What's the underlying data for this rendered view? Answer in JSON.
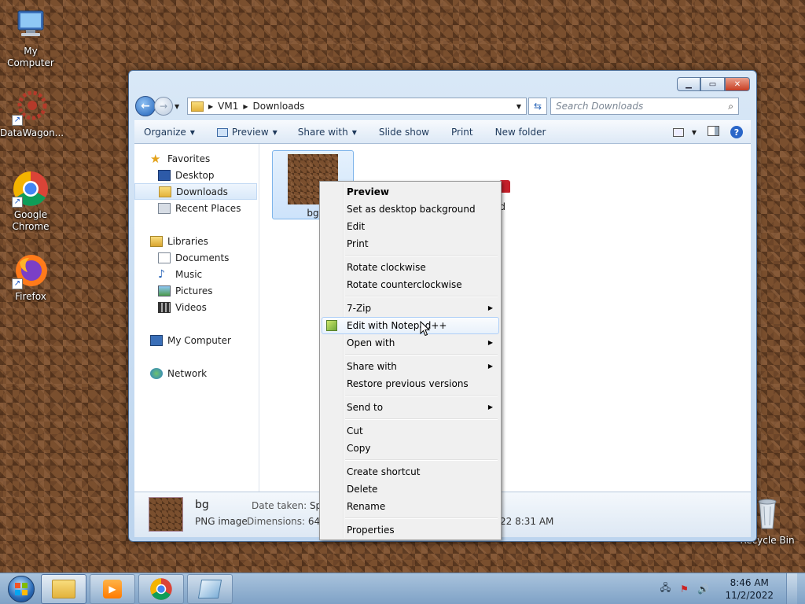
{
  "desktop": {
    "icons": [
      {
        "label": "My Computer"
      },
      {
        "label": "DataWagon..."
      },
      {
        "label": "Google Chrome"
      },
      {
        "label": "Firefox"
      },
      {
        "label": "Recycle Bin"
      }
    ]
  },
  "window": {
    "address": {
      "crumbs": [
        "VM1",
        "Downloads"
      ]
    },
    "search_placeholder": "Search Downloads",
    "toolbar": {
      "organize": "Organize",
      "preview": "Preview",
      "share_with": "Share with",
      "slide_show": "Slide show",
      "print": "Print",
      "new_folder": "New folder"
    },
    "nav": {
      "favorites": "Favorites",
      "desktop": "Desktop",
      "downloads": "Downloads",
      "recent_places": "Recent Places",
      "libraries": "Libraries",
      "documents": "Documents",
      "music": "Music",
      "pictures": "Pictures",
      "videos": "Videos",
      "my_computer": "My Computer",
      "network": "Network"
    },
    "files": [
      {
        "name": "bg"
      },
      {
        "name": "ed"
      }
    ],
    "details": {
      "name": "bg",
      "type": "PNG image",
      "date_taken_label": "Date taken:",
      "date_taken_value": "Spec",
      "dimensions_label": "Dimensions:",
      "dimensions_value": "64 x",
      "modified_fragment": "22 8:31 AM"
    }
  },
  "context_menu": {
    "items": [
      {
        "label": "Preview"
      },
      {
        "label": "Set as desktop background"
      },
      {
        "label": "Edit"
      },
      {
        "label": "Print"
      },
      {
        "label": "Rotate clockwise"
      },
      {
        "label": "Rotate counterclockwise"
      },
      {
        "label": "7-Zip"
      },
      {
        "label": "Edit with Notepad++"
      },
      {
        "label": "Open with"
      },
      {
        "label": "Share with"
      },
      {
        "label": "Restore previous versions"
      },
      {
        "label": "Send to"
      },
      {
        "label": "Cut"
      },
      {
        "label": "Copy"
      },
      {
        "label": "Create shortcut"
      },
      {
        "label": "Delete"
      },
      {
        "label": "Rename"
      },
      {
        "label": "Properties"
      }
    ]
  },
  "taskbar": {
    "time": "8:46 AM",
    "date": "11/2/2022"
  }
}
